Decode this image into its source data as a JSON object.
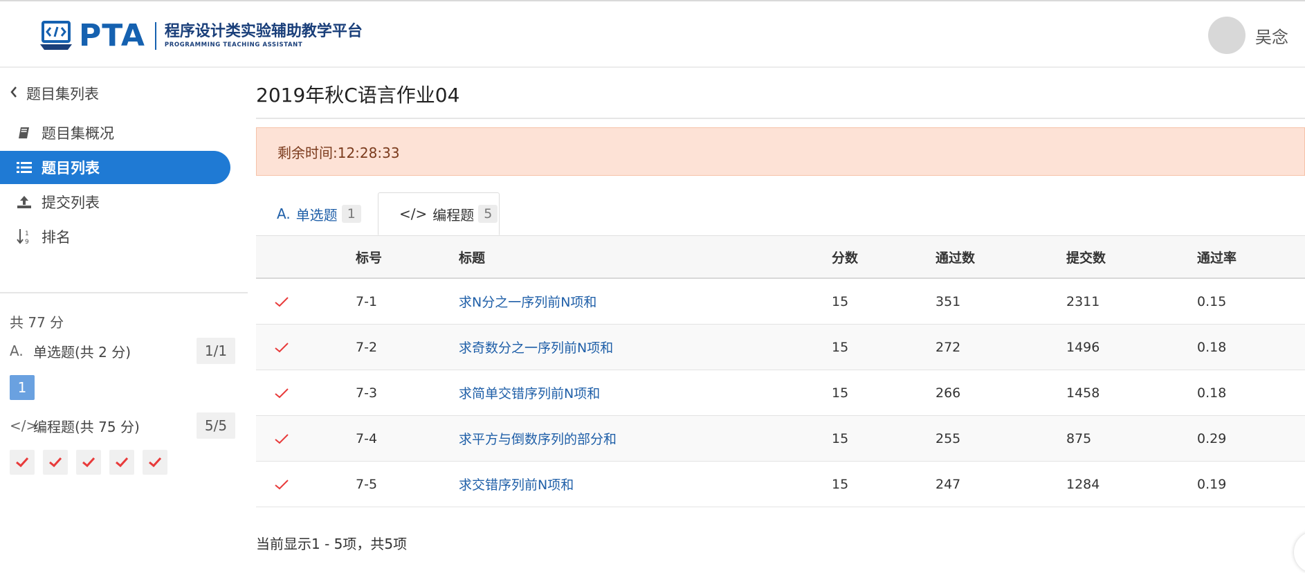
{
  "header": {
    "logo_text": "PTA",
    "logo_title": "程序设计类实验辅助教学平台",
    "logo_subtitle": "PROGRAMMING TEACHING ASSISTANT",
    "user_name": "吴念"
  },
  "sidebar": {
    "back_label": "题目集列表",
    "nav_items": [
      {
        "label": "题目集概况",
        "icon": "book-icon",
        "active": false
      },
      {
        "label": "题目列表",
        "icon": "list-icon",
        "active": true
      },
      {
        "label": "提交列表",
        "icon": "upload-icon",
        "active": false
      },
      {
        "label": "排名",
        "icon": "sort-numeric-icon",
        "active": false
      }
    ],
    "total": "共 77 分",
    "groups": [
      {
        "icon_glyph": "A.",
        "label": "单选题(共 2 分)",
        "count": "1/1",
        "buttons": [
          "1"
        ]
      },
      {
        "icon_glyph": "</>",
        "label": "编程题(共 75 分)",
        "count": "5/5",
        "buttons": [
          "check",
          "check",
          "check",
          "check",
          "check"
        ]
      }
    ]
  },
  "main": {
    "title": "2019年秋C语言作业04",
    "remaining_time": "剩余时间:12:28:33",
    "tabs": [
      {
        "icon_glyph": "A.",
        "label": "单选题",
        "count": "1",
        "active": false
      },
      {
        "icon_glyph": "</>",
        "label": "编程题",
        "count": "5",
        "active": true
      }
    ],
    "table": {
      "headers": [
        "",
        "标号",
        "标题",
        "分数",
        "通过数",
        "提交数",
        "通过率"
      ],
      "rows": [
        {
          "status": "accepted",
          "id": "7-1",
          "title": "求N分之一序列前N项和",
          "score": "15",
          "passed": "351",
          "submitted": "2311",
          "rate": "0.15"
        },
        {
          "status": "accepted",
          "id": "7-2",
          "title": "求奇数分之一序列前N项和",
          "score": "15",
          "passed": "272",
          "submitted": "1496",
          "rate": "0.18"
        },
        {
          "status": "accepted",
          "id": "7-3",
          "title": "求简单交错序列前N项和",
          "score": "15",
          "passed": "266",
          "submitted": "1458",
          "rate": "0.18"
        },
        {
          "status": "accepted",
          "id": "7-4",
          "title": "求平方与倒数序列的部分和",
          "score": "15",
          "passed": "255",
          "submitted": "875",
          "rate": "0.29"
        },
        {
          "status": "accepted",
          "id": "7-5",
          "title": "求交错序列前N项和",
          "score": "15",
          "passed": "247",
          "submitted": "1284",
          "rate": "0.19"
        }
      ]
    },
    "footer": "当前显示1 - 5项，共5项"
  },
  "colors": {
    "primary": "#1f7ad4",
    "link": "#1f5fa8",
    "alert_bg": "#fde2d6",
    "check": "#e83a3a"
  }
}
